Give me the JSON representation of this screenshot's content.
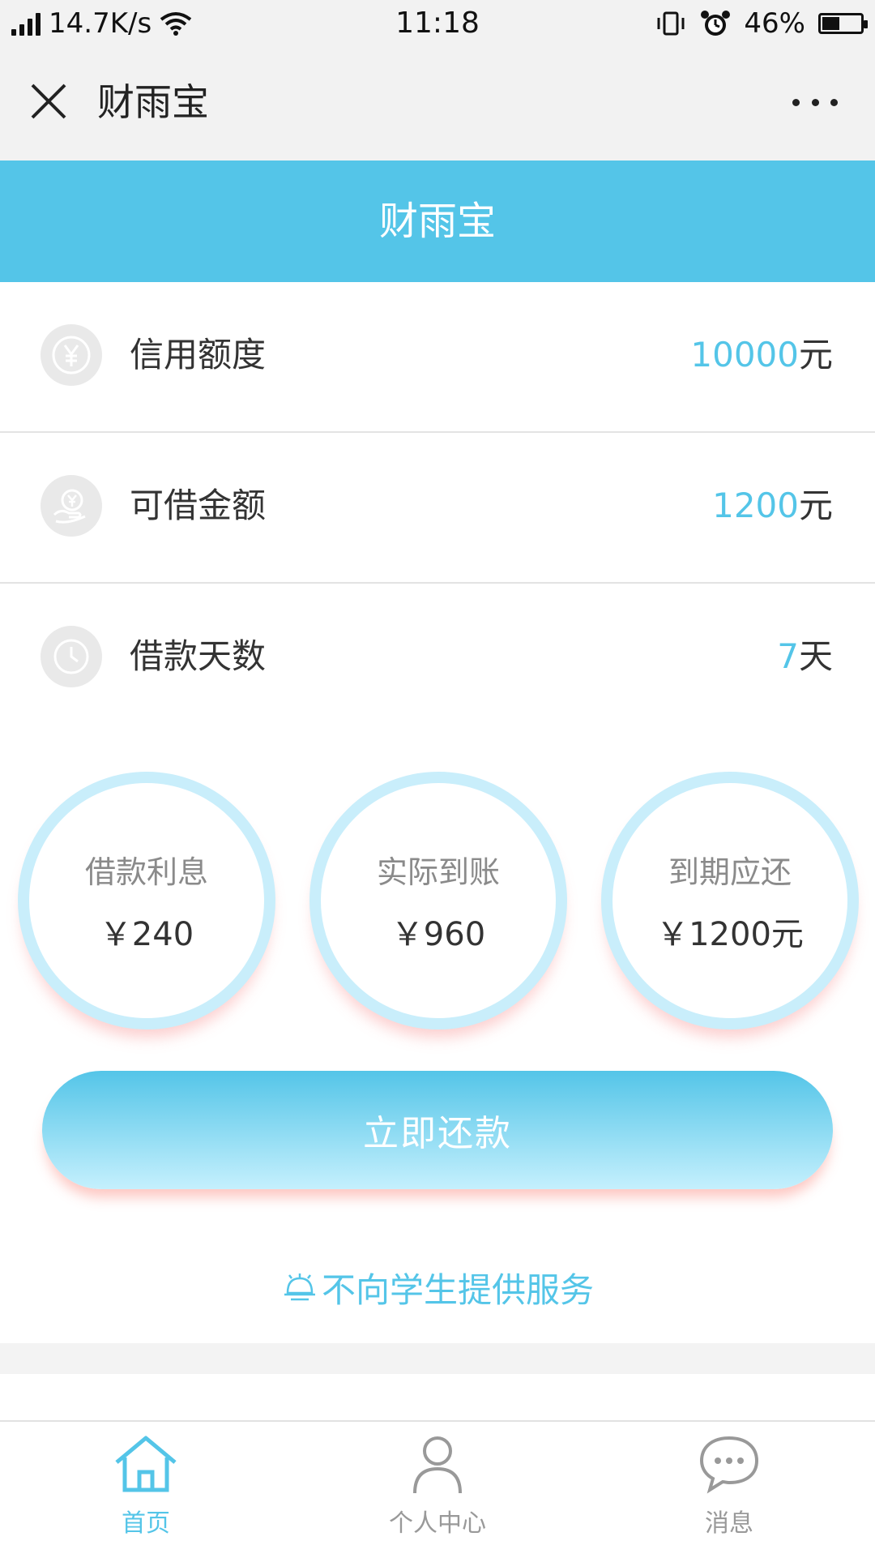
{
  "status_bar": {
    "speed": "14.7K/s",
    "time": "11:18",
    "battery": "46%",
    "battery_level": 0.46
  },
  "nav": {
    "title": "财雨宝"
  },
  "header": {
    "title": "财雨宝"
  },
  "rows": [
    {
      "label": "信用额度",
      "value": "10000",
      "unit": "元",
      "icon": "yen-coin-icon"
    },
    {
      "label": "可借金额",
      "value": "1200",
      "unit": "元",
      "icon": "hand-money-icon"
    },
    {
      "label": "借款天数",
      "value": "7",
      "unit": "天",
      "icon": "clock-icon"
    }
  ],
  "summary": [
    {
      "label": "借款利息",
      "value": "￥240"
    },
    {
      "label": "实际到账",
      "value": "￥960"
    },
    {
      "label": "到期应还",
      "value": "￥1200元"
    }
  ],
  "repay_button": "立即还款",
  "notice": "不向学生提供服务",
  "tabs": [
    {
      "label": "首页",
      "icon": "home-icon",
      "active": true
    },
    {
      "label": "个人中心",
      "icon": "person-icon",
      "active": false
    },
    {
      "label": "消息",
      "icon": "chat-bubble-icon",
      "active": false
    }
  ],
  "colors": {
    "accent": "#54c5e8",
    "circle_ring": "#c9eefb",
    "shadow": "#f57878"
  }
}
